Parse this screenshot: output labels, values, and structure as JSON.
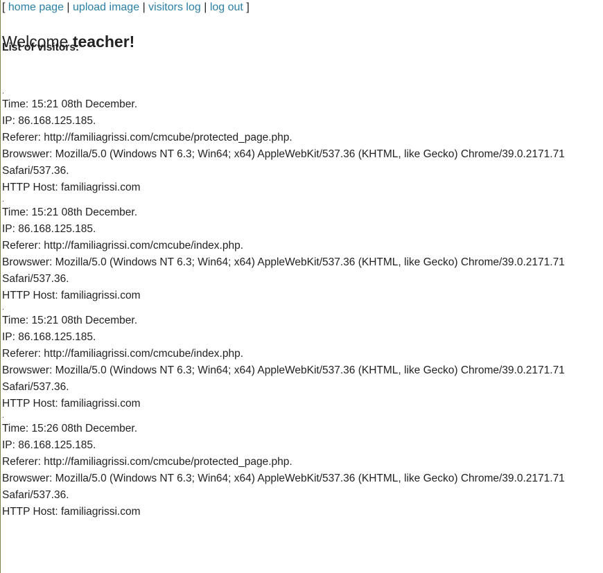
{
  "nav": {
    "open_bracket": "[",
    "close_bracket": "]",
    "separator": "|",
    "links": [
      "home page",
      "upload image",
      "visitors log",
      "log out"
    ],
    "link_color": "#2a7fa5"
  },
  "welcome": {
    "prefix": "Welcome",
    "user": "teacher!"
  },
  "list_title": "List of visitors:",
  "entries": [
    {
      "dot": ".",
      "time": "Time: 15:21 08th December.",
      "ip": "IP: 86.168.125.185.",
      "referer": "Referer: http://familiagrissi.com/cmcube/protected_page.php.",
      "browser_1": "Browswer: Mozilla/5.0 (Windows NT 6.3; Win64; x64) AppleWebKit/537.36 (KHTML, like Gecko) Chrome/39.0.2171.71",
      "browser_2": "Safari/537.36.",
      "host": "HTTP Host: familiagrissi.com"
    },
    {
      "dot": ".",
      "time": "Time: 15:21 08th December.",
      "ip": "IP: 86.168.125.185.",
      "referer": "Referer: http://familiagrissi.com/cmcube/index.php.",
      "browser_1": "Browswer: Mozilla/5.0 (Windows NT 6.3; Win64; x64) AppleWebKit/537.36 (KHTML, like Gecko) Chrome/39.0.2171.71",
      "browser_2": "Safari/537.36.",
      "host": "HTTP Host: familiagrissi.com"
    },
    {
      "dot": ".",
      "time": "Time: 15:21 08th December.",
      "ip": "IP: 86.168.125.185.",
      "referer": "Referer: http://familiagrissi.com/cmcube/index.php.",
      "browser_1": "Browswer: Mozilla/5.0 (Windows NT 6.3; Win64; x64) AppleWebKit/537.36 (KHTML, like Gecko) Chrome/39.0.2171.71",
      "browser_2": "Safari/537.36.",
      "host": "HTTP Host: familiagrissi.com"
    },
    {
      "dot": ".",
      "time": "Time: 15:26 08th December.",
      "ip": "IP: 86.168.125.185.",
      "referer": "Referer: http://familiagrissi.com/cmcube/protected_page.php.",
      "browser_1": "Browswer: Mozilla/5.0 (Windows NT 6.3; Win64; x64) AppleWebKit/537.36 (KHTML, like Gecko) Chrome/39.0.2171.71",
      "browser_2": "Safari/537.36.",
      "host": "HTTP Host: familiagrissi.com"
    }
  ]
}
